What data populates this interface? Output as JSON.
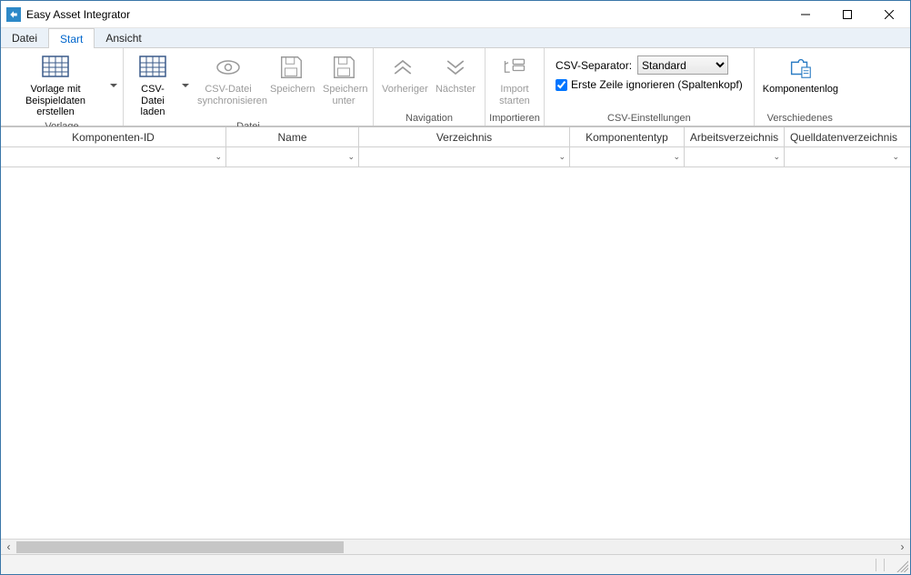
{
  "window": {
    "title": "Easy Asset Integrator"
  },
  "menu": {
    "tabs": [
      "Datei",
      "Start",
      "Ansicht"
    ],
    "active_index": 1
  },
  "ribbon": {
    "groups": {
      "vorlage": {
        "label": "Vorlage",
        "template_btn": "Vorlage mit\nBeispieldaten erstellen"
      },
      "datei": {
        "label": "Datei",
        "load_btn": "CSV-Datei\nladen",
        "sync_btn": "CSV-Datei\nsynchronisieren",
        "save_btn": "Speichern",
        "save_as_btn": "Speichern\nunter"
      },
      "navigation": {
        "label": "Navigation",
        "prev_btn": "Vorheriger",
        "next_btn": "Nächster"
      },
      "importieren": {
        "label": "Importieren",
        "start_btn": "Import\nstarten"
      },
      "csv": {
        "label": "CSV-Einstellungen",
        "separator_label": "CSV-Separator:",
        "separator_value": "Standard",
        "separator_options": [
          "Standard"
        ],
        "ignore_first_row_label": "Erste Zeile ignorieren (Spaltenkopf)",
        "ignore_first_row_checked": true
      },
      "misc": {
        "label": "Verschiedenes",
        "log_btn": "Komponentenlog"
      }
    }
  },
  "grid": {
    "columns": [
      "Komponenten-ID",
      "Name",
      "Verzeichnis",
      "Komponententyp",
      "Arbeitsverzeichnis",
      "Quelldatenverzeichnis"
    ],
    "rows": []
  }
}
